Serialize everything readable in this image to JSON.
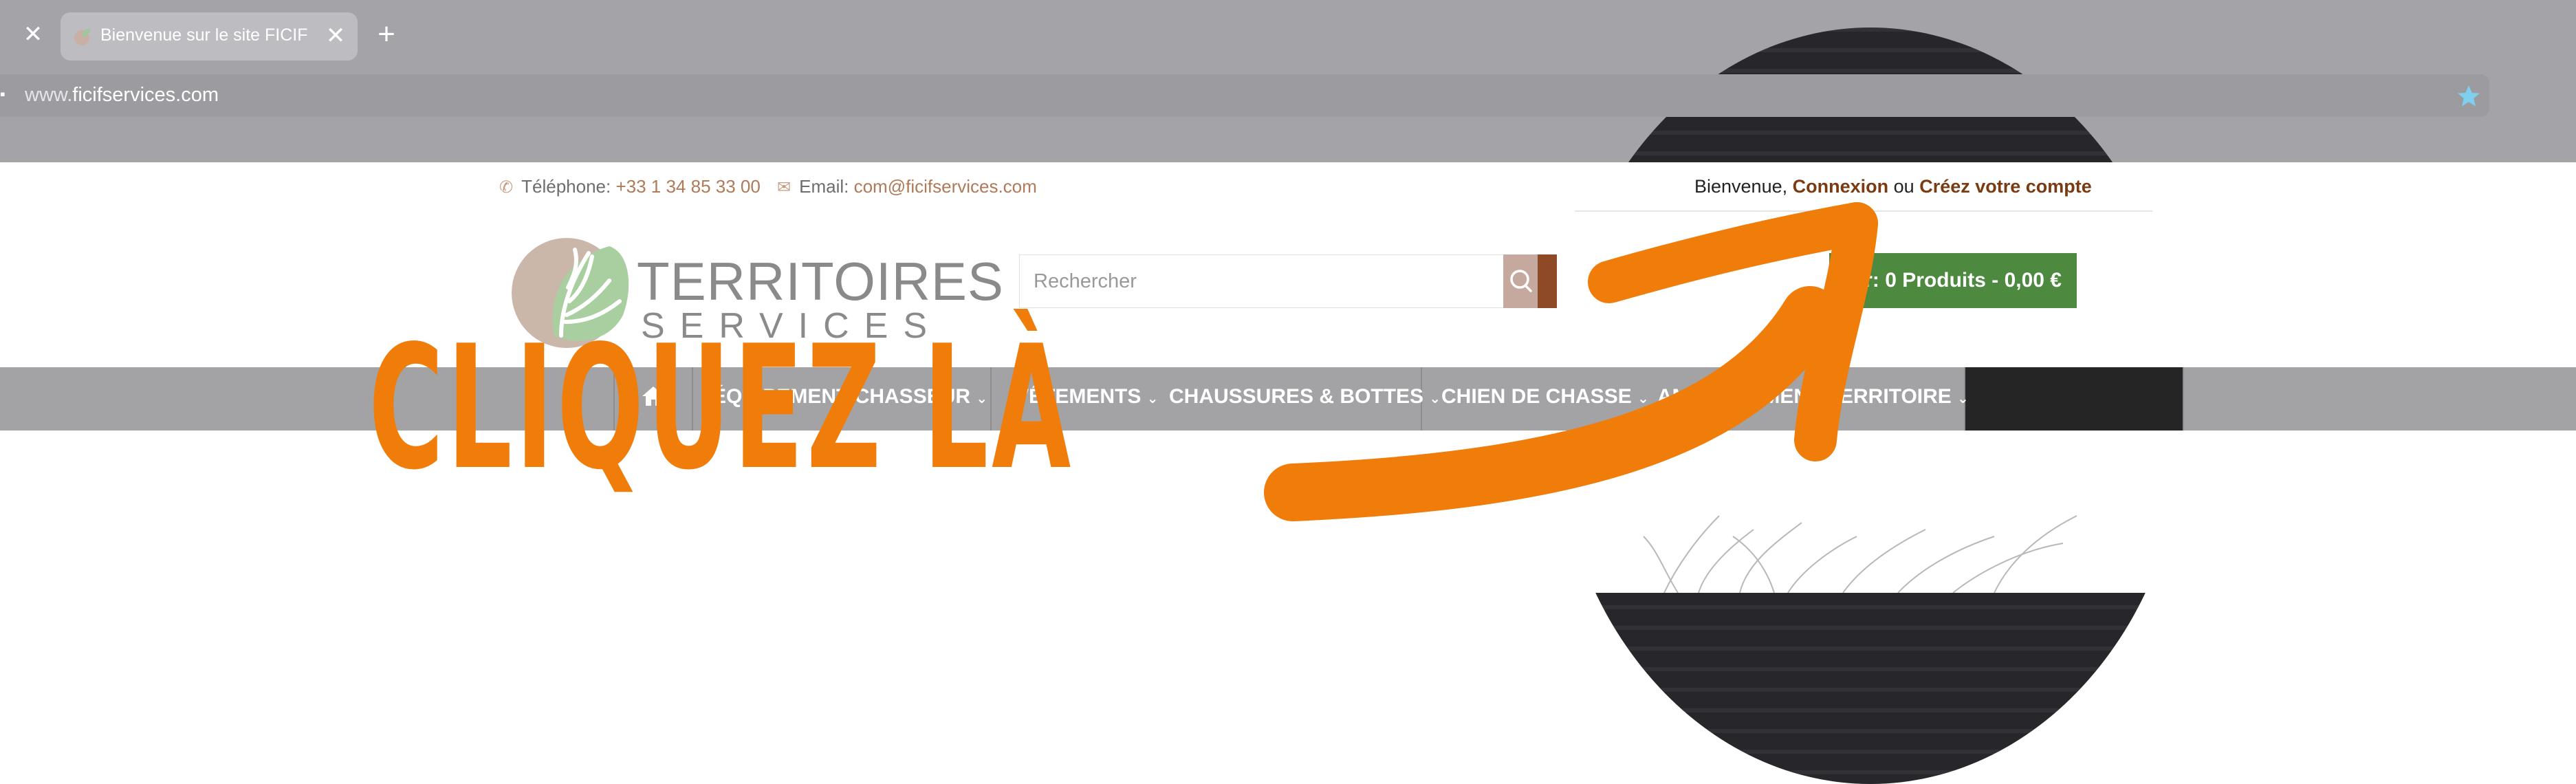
{
  "browser": {
    "tab_title": "Bienvenue sur le site FICIF Serv",
    "url_prefix": "www.",
    "url_domain": "ficifservices.com"
  },
  "topbar": {
    "phone_label": "Téléphone:",
    "phone_value": "+33 1 34 85 33 00",
    "email_label": "Email:",
    "email_value": "com@ficifservices.com",
    "welcome_text": "Bienvenue,",
    "login_link": "Connexion",
    "or_text": "ou",
    "register_link": "Créez votre compte"
  },
  "header": {
    "logo_line1": "TERRITOIRES",
    "logo_line2": "SERVICES",
    "search_placeholder": "Rechercher",
    "cart_label": "nier: 0 Produits - 0,00 €"
  },
  "nav": {
    "items": [
      {
        "label": "ÉQUIPEMENT CHASSEUR"
      },
      {
        "label": "VÊTEMENTS"
      },
      {
        "label": "CHAUSSURES & BOTTES"
      },
      {
        "label": "CHIEN DE CHASSE"
      },
      {
        "label": "AMÉNAGEMENT TERRITOIRE"
      }
    ]
  },
  "overlay": {
    "cta_text": "CLIQUEZ LÀ"
  },
  "colors": {
    "accent_orange": "#f07d0a",
    "brand_brown": "#7a3b12",
    "cart_green": "#4d8a3f",
    "nav_gray": "#a3a3a6"
  }
}
